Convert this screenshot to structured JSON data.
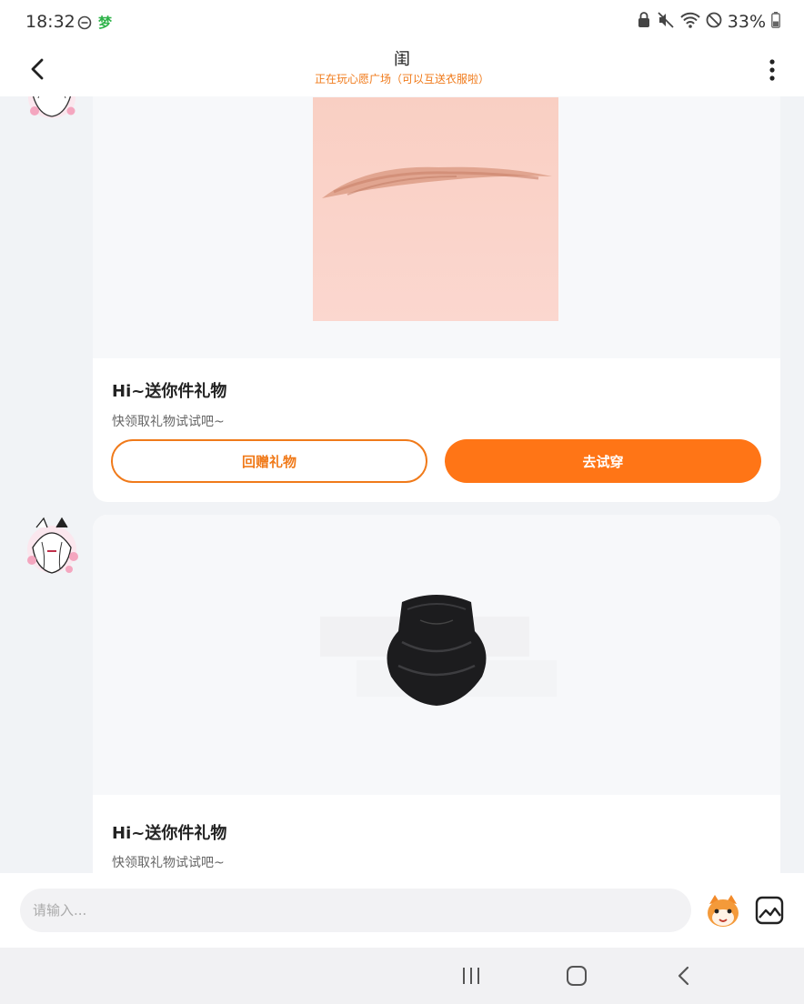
{
  "status_bar": {
    "time": "18:32",
    "app_badge": "梦",
    "battery": "33%"
  },
  "header": {
    "title": "闺",
    "subtitle": "正在玩心愿广场（可以互送衣服啦）"
  },
  "messages": [
    {
      "gift_image_icon": "eyebrow-gift-image",
      "title": "Hi~送你件礼物",
      "desc": "快领取礼物试试吧~",
      "return_label": "回赠礼物",
      "try_label": "去试穿"
    },
    {
      "gift_image_icon": "black-neck-gaiter-gift-image",
      "title": "Hi~送你件礼物",
      "desc": "快领取礼物试试吧~"
    }
  ],
  "input": {
    "placeholder": "请输入..."
  },
  "colors": {
    "accent": "#ff7516",
    "accent_text": "#f07a1a",
    "badge_green": "#2fb34a"
  }
}
